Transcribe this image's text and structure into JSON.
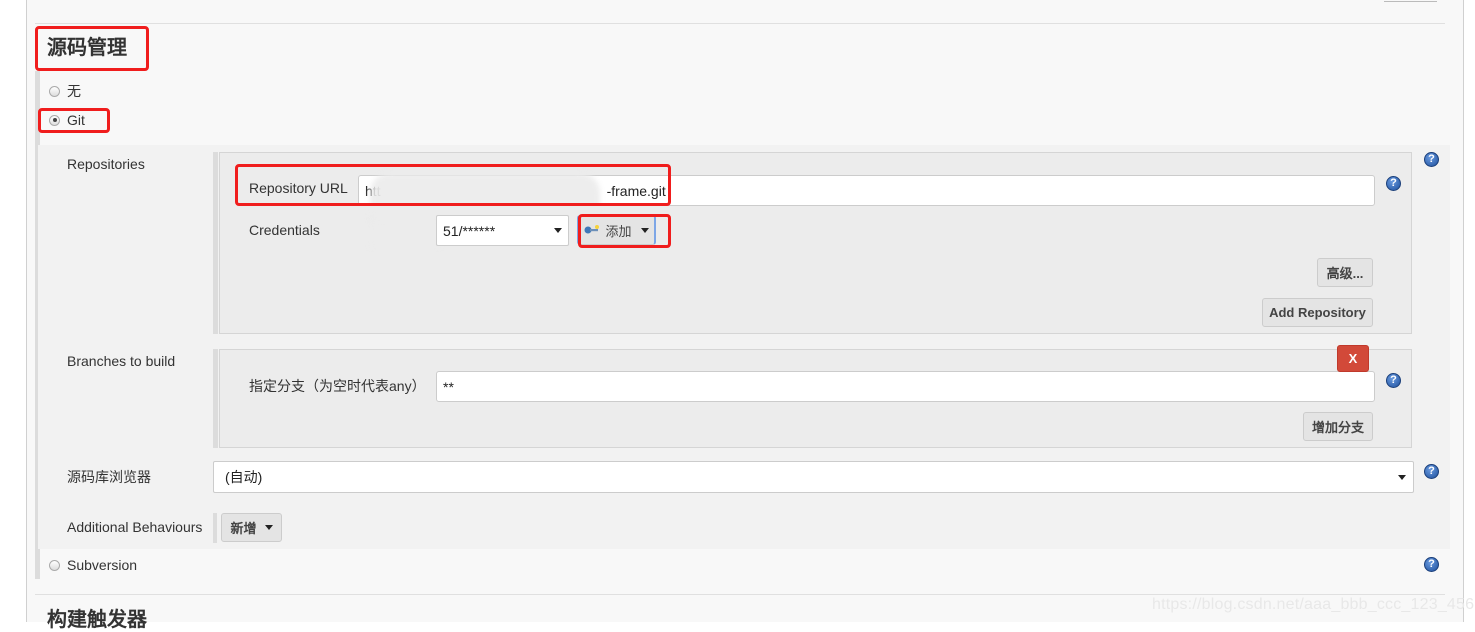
{
  "section": {
    "title": "源码管理",
    "next_title": "构建触发器"
  },
  "scm_options": [
    {
      "label": "无",
      "selected": false
    },
    {
      "label": "Git",
      "selected": true
    },
    {
      "label": "Subversion",
      "selected": false
    }
  ],
  "git": {
    "repositories_label": "Repositories",
    "repository_url_label": "Repository URL",
    "repository_url_value_prefix": "htt",
    "repository_url_value_suffix": "-frame.git",
    "credentials_label": "Credentials",
    "credentials_value": "51/******",
    "add_credentials_button": "添加",
    "advanced_button": "高级...",
    "add_repository_button": "Add Repository",
    "branches_label": "Branches to build",
    "branch_specifier_label": "指定分支（为空时代表any）",
    "branch_specifier_value": "**",
    "delete_branch_button": "X",
    "add_branch_button": "增加分支",
    "browser_label": "源码库浏览器",
    "browser_value": "(自动)",
    "additional_behaviours_label": "Additional Behaviours",
    "add_behaviour_button": "新增"
  },
  "help_icon_glyph": "?",
  "watermark": "https://blog.csdn.net/aaa_bbb_ccc_123_456",
  "colors": {
    "highlight_red": "#f01d1d",
    "delete_red": "#d24939",
    "help_blue": "#1d4f9c"
  }
}
